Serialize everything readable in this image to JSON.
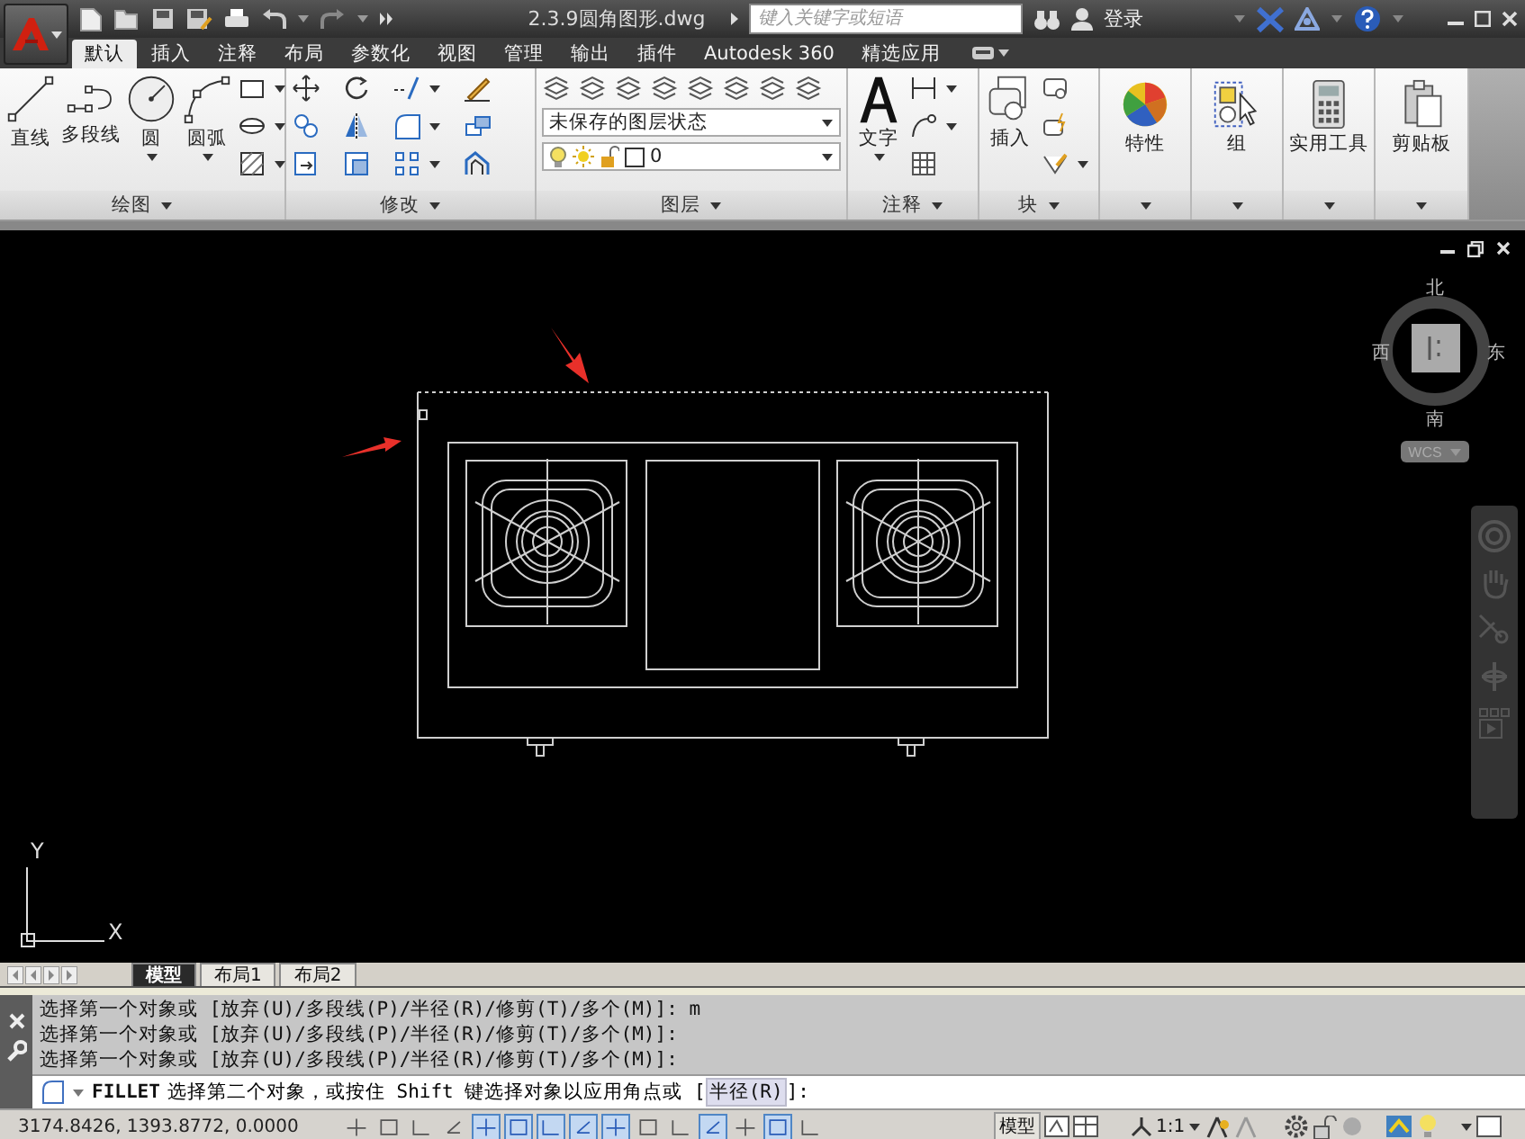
{
  "window": {
    "title": "2.3.9圆角图形.dwg"
  },
  "search": {
    "placeholder": "键入关键字或短语"
  },
  "sign_in": "登录",
  "ribbon_tabs": [
    {
      "label": "默认",
      "selected": true
    },
    {
      "label": "插入",
      "selected": false
    },
    {
      "label": "注释",
      "selected": false
    },
    {
      "label": "布局",
      "selected": false
    },
    {
      "label": "参数化",
      "selected": false
    },
    {
      "label": "视图",
      "selected": false
    },
    {
      "label": "管理",
      "selected": false
    },
    {
      "label": "输出",
      "selected": false
    },
    {
      "label": "插件",
      "selected": false
    },
    {
      "label": "Autodesk 360",
      "selected": false
    },
    {
      "label": "精选应用",
      "selected": false
    }
  ],
  "panels": [
    {
      "kind": "draw",
      "title": "绘图",
      "tools": [
        {
          "label": "直线",
          "menu": false
        },
        {
          "label": "多段线",
          "menu": false
        },
        {
          "label": "圆",
          "menu": true
        },
        {
          "label": "圆弧",
          "menu": true
        }
      ]
    },
    {
      "kind": "modify",
      "title": "修改"
    },
    {
      "kind": "layers",
      "title": "图层",
      "layer_state": "未保存的图层状态",
      "current_layer": "0"
    },
    {
      "kind": "annotation",
      "title": "注释",
      "tools": [
        {
          "label": "文字",
          "menu": true
        }
      ]
    },
    {
      "kind": "block",
      "title": "块",
      "tools": [
        {
          "label": "插入",
          "menu": false
        }
      ]
    },
    {
      "kind": "properties",
      "tools": [
        {
          "label": "特性",
          "menu": false
        }
      ]
    },
    {
      "kind": "groups",
      "tools": [
        {
          "label": "组",
          "menu": false
        }
      ]
    },
    {
      "kind": "utilities",
      "tools": [
        {
          "label": "实用工具",
          "menu": false
        }
      ]
    },
    {
      "kind": "clipboard",
      "tools": [
        {
          "label": "剪贴板",
          "menu": false
        }
      ]
    }
  ],
  "viewcube": {
    "north": "北",
    "south": "南",
    "east": "东",
    "west": "西",
    "ucs": "WCS"
  },
  "ucs_icon": {
    "x": "X",
    "y": "Y"
  },
  "layout_tabs": [
    {
      "label": "模型",
      "selected": true
    },
    {
      "label": "布局1",
      "selected": false
    },
    {
      "label": "布局2",
      "selected": false
    }
  ],
  "command_history": [
    "选择第一个对象或 [放弃(U)/多段线(P)/半径(R)/修剪(T)/多个(M)]: m",
    "选择第一个对象或 [放弃(U)/多段线(P)/半径(R)/修剪(T)/多个(M)]:",
    "选择第一个对象或 [放弃(U)/多段线(P)/半径(R)/修剪(T)/多个(M)]:"
  ],
  "command_line": {
    "command": "FILLET",
    "prompt": "选择第二个对象，或按住 Shift 键选择对象以应用角点或 [",
    "option": "半径(R)",
    "suffix": "]:"
  },
  "status_bar": {
    "coordinates": "3174.8426, 1393.8772, 0.0000",
    "space": "模型",
    "scale": "1:1",
    "toggles": [
      {
        "on": false
      },
      {
        "on": false
      },
      {
        "on": false
      },
      {
        "on": false
      },
      {
        "on": true
      },
      {
        "on": true
      },
      {
        "on": true
      },
      {
        "on": true
      },
      {
        "on": true
      },
      {
        "on": false
      },
      {
        "on": false
      },
      {
        "on": true
      },
      {
        "on": false
      },
      {
        "on": true
      },
      {
        "on": false
      }
    ]
  }
}
